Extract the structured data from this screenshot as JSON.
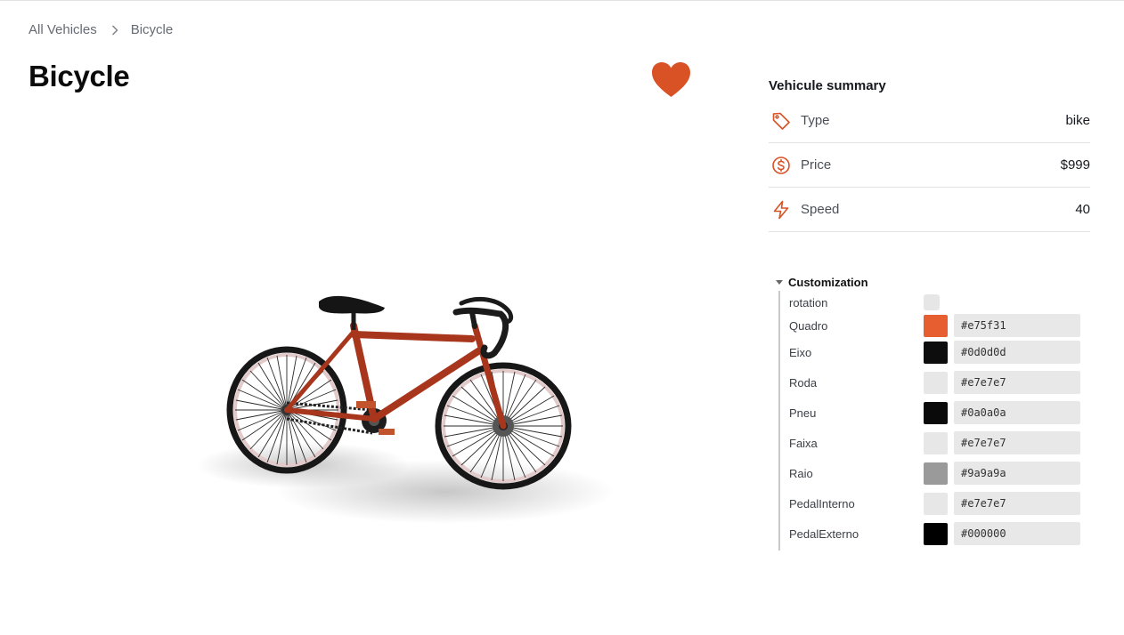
{
  "breadcrumb": {
    "root": "All Vehicles",
    "current": "Bicycle"
  },
  "title": "Bicycle",
  "favorite": {
    "active": true,
    "color": "#d85226"
  },
  "summary": {
    "heading": "Vehicule summary",
    "rows": [
      {
        "icon": "tag-icon",
        "label": "Type",
        "value": "bike"
      },
      {
        "icon": "dollar-circle-icon",
        "label": "Price",
        "value": "$999"
      },
      {
        "icon": "lightning-icon",
        "label": "Speed",
        "value": "40"
      }
    ]
  },
  "customization": {
    "title": "Customization",
    "rotation_label": "rotation",
    "rotation_checked": false,
    "fields": [
      {
        "label": "Quadro",
        "color": "#e75f31",
        "value": "#e75f31"
      },
      {
        "label": "Eixo",
        "color": "#0d0d0d",
        "value": "#0d0d0d"
      },
      {
        "label": "Roda",
        "color": "#e7e7e7",
        "value": "#e7e7e7"
      },
      {
        "label": "Pneu",
        "color": "#0a0a0a",
        "value": "#0a0a0a"
      },
      {
        "label": "Faixa",
        "color": "#e7e7e7",
        "value": "#e7e7e7"
      },
      {
        "label": "Raio",
        "color": "#9a9a9a",
        "value": "#9a9a9a"
      },
      {
        "label": "PedalInterno",
        "color": "#e7e7e7",
        "value": "#e7e7e7"
      },
      {
        "label": "PedalExterno",
        "color": "#000000",
        "value": "#000000"
      }
    ]
  },
  "colors": {
    "accent": "#d85226",
    "frame": "#a8361c"
  }
}
